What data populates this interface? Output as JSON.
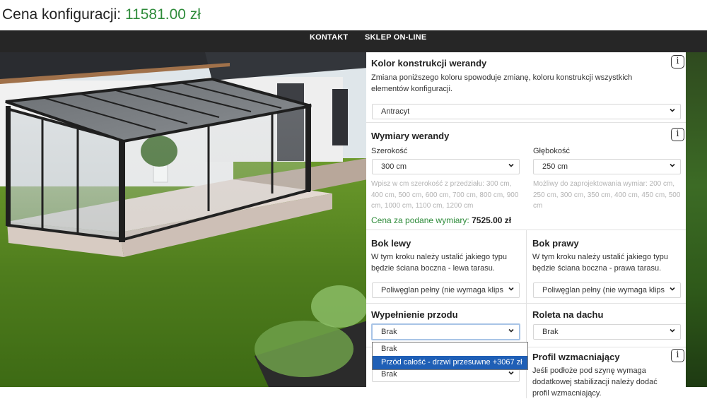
{
  "header": {
    "price_label": "Cena konfiguracji:",
    "price_value": "11581.00 zł"
  },
  "nav": {
    "items": [
      {
        "label": "KONTAKT"
      },
      {
        "label": "SKLEP ON-LINE"
      }
    ]
  },
  "color_section": {
    "title": "Kolor konstrukcji werandy",
    "description": "Zmiana poniższego koloru spowoduje zmianę, koloru konstrukcji wszystkich elementów konfiguracji.",
    "select_value": "Antracyt"
  },
  "dimensions": {
    "title": "Wymiary werandy",
    "width": {
      "label": "Szerokość",
      "value": "300 cm",
      "hint": "Wpisz w cm szerokość z przedziału: 300 cm, 400 cm, 500 cm, 600 cm, 700 cm, 800 cm, 900 cm, 1000 cm, 1100 cm, 1200 cm"
    },
    "depth": {
      "label": "Głębokość",
      "value": "250 cm",
      "hint": "Możliwy do zaprojektowania wymiar: 200 cm, 250 cm, 300 cm, 350 cm, 400 cm, 450 cm, 500 cm"
    },
    "price_label": "Cena za podane wymiary:",
    "price_value": "7525.00 zł"
  },
  "side_left": {
    "title": "Bok lewy",
    "description": "W tym kroku należy ustalić jakiego typu będzie ściana boczna - lewa tarasu.",
    "select_value": "Poliwęglan pełny (nie wymaga klips"
  },
  "side_right": {
    "title": "Bok prawy",
    "description": "W tym kroku należy ustalić jakiego typu będzie ściana boczna - prawa tarasu.",
    "select_value": "Poliwęglan pełny (nie wymaga klips"
  },
  "front_fill": {
    "title": "Wypełnienie przodu",
    "select_value": "Brak",
    "options": [
      "Brak",
      "Przód całość - drzwi przesuwne +3067 zł"
    ],
    "behind_select_value": "Brak"
  },
  "roof_blind": {
    "title": "Roleta na dachu",
    "select_value": "Brak"
  },
  "reinforcement": {
    "title": "Profil wzmacniający",
    "description": "Jeśli podłoże pod szynę wymaga dodatkowej stabilizacji należy dodać profil wzmacniający."
  },
  "icons": {
    "info": "i",
    "chevron": "chevron-down-icon"
  }
}
